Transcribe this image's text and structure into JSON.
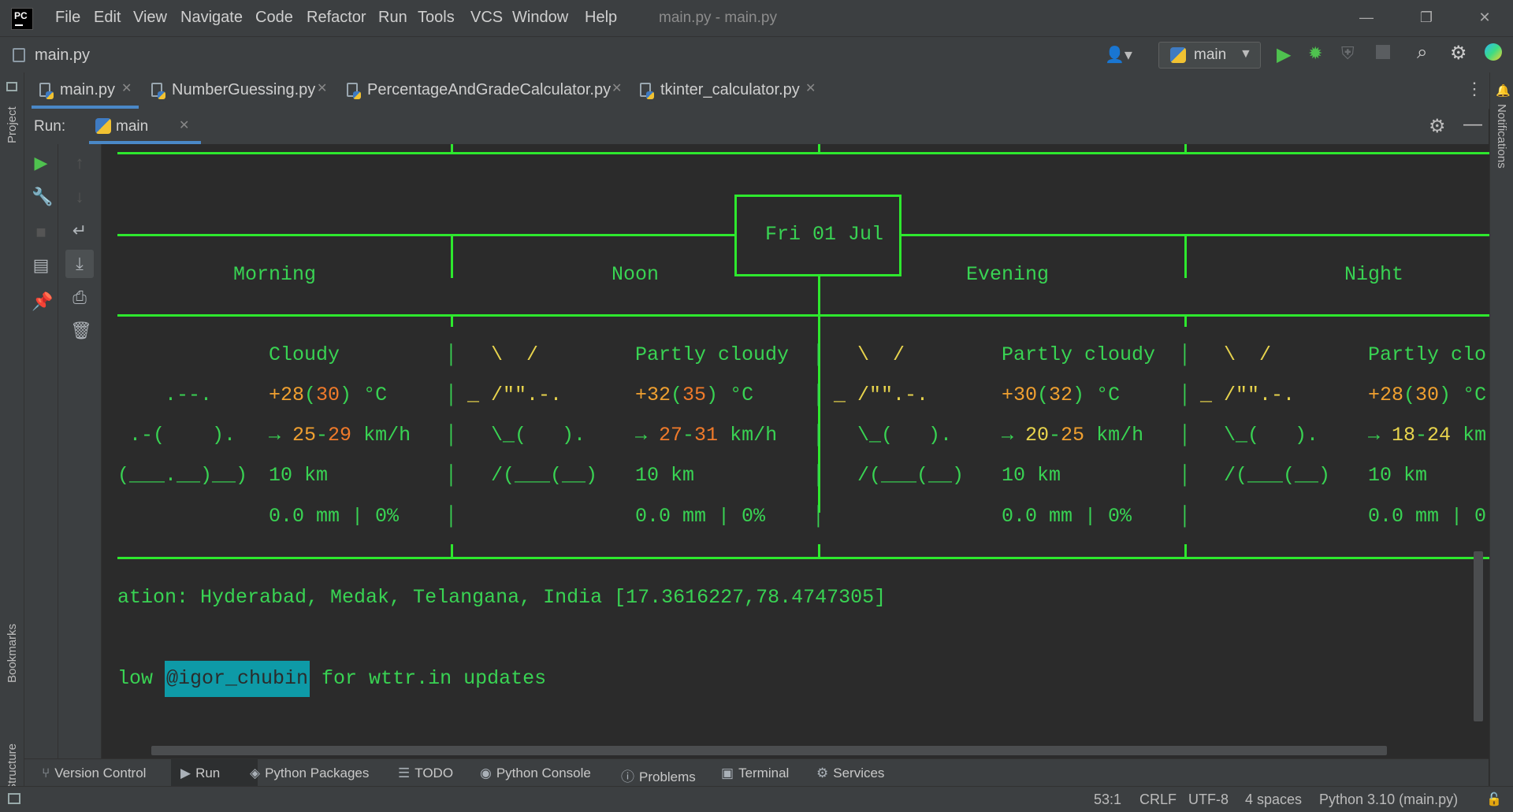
{
  "menu": [
    "File",
    "Edit",
    "View",
    "Navigate",
    "Code",
    "Refactor",
    "Run",
    "Tools",
    "VCS",
    "Window",
    "Help"
  ],
  "window_title": "main.py - main.py",
  "nav": {
    "file": "main.py",
    "run_config": "main"
  },
  "tabs": [
    {
      "label": "main.py"
    },
    {
      "label": "NumberGuessing.py"
    },
    {
      "label": "PercentageAndGradeCalculator.py"
    },
    {
      "label": "tkinter_calculator.py"
    }
  ],
  "side": {
    "project": "Project",
    "bookmarks": "Bookmarks",
    "structure": "Structure",
    "notifications": "Notifications"
  },
  "run": {
    "label": "Run:",
    "tab": "main"
  },
  "console": {
    "date": "Fri 01 Jul",
    "periods": [
      "Morning",
      "Noon",
      "Evening",
      "Night"
    ],
    "cols": [
      {
        "art": [
          "",
          "    .--.",
          " .-(    ).",
          "(___.__)__)"
        ],
        "cond": "Cloudy",
        "t1": "+28",
        "t2": "30",
        "unit": " °C",
        "arrow": "→ ",
        "w1": "25",
        "w2": "29",
        "wunit": " km/h",
        "vis": "10 km",
        "rain": "0.0 mm | 0%"
      },
      {
        "art": [
          "  \\  /",
          "_ /\"\".-.",
          "  \\_(   ).",
          "  /(___(__)"
        ],
        "cond": "Partly cloudy",
        "t1": "+32",
        "t2": "35",
        "unit": " °C",
        "arrow": "→ ",
        "w1": "27",
        "w2": "31",
        "wunit": " km/h",
        "vis": "10 km",
        "rain": "0.0 mm | 0%"
      },
      {
        "art": [
          "  \\  /",
          "_ /\"\".-.",
          "  \\_(   ).",
          "  /(___(__)"
        ],
        "cond": "Partly cloudy",
        "t1": "+30",
        "t2": "32",
        "unit": " °C",
        "arrow": "→ ",
        "w1": "20",
        "w2": "25",
        "wunit": " km/h",
        "vis": "10 km",
        "rain": "0.0 mm | 0%"
      },
      {
        "art": [
          "  \\  /",
          "_ /\"\".-.",
          "  \\_(   ).",
          "  /(___(__)"
        ],
        "cond": "Partly clo",
        "t1": "+28",
        "t2": "30",
        "unit": " °C",
        "arrow": "→ ",
        "w1": "18",
        "w2": "24",
        "wunit": " km",
        "vis": "10 km",
        "rain": "0.0 mm | 0"
      }
    ],
    "location": "ation: Hyderabad, Medak, Telangana, India [17.3616227,78.4747305]",
    "follow_prefix": "low ",
    "follow_handle": "@igor_chubin",
    "follow_suffix": " for wttr.in updates"
  },
  "bottom_tabs": [
    "Version Control",
    "Run",
    "Python Packages",
    "TODO",
    "Python Console",
    "Problems",
    "Terminal",
    "Services"
  ],
  "status": {
    "pos": "53:1",
    "eol": "CRLF",
    "enc": "UTF-8",
    "indent": "4 spaces",
    "interp": "Python 3.10 (main.py)"
  }
}
